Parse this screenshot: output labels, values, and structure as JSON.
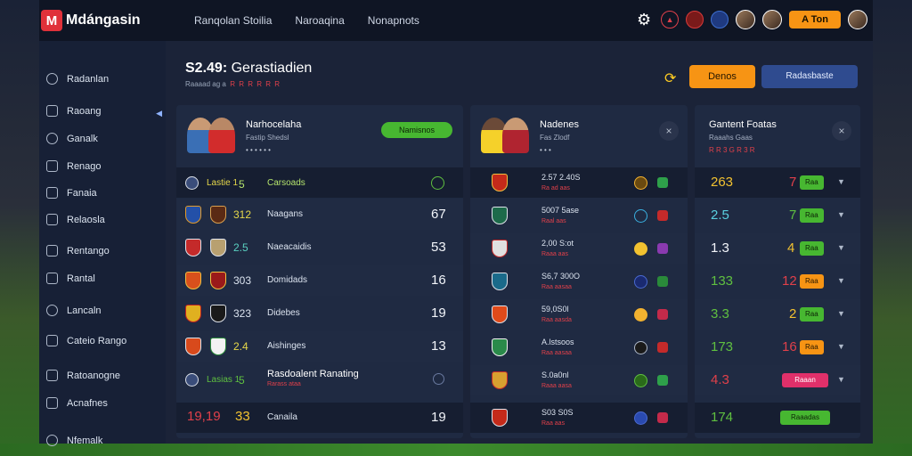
{
  "app": {
    "logo_mark": "M",
    "name": "Mdángasin"
  },
  "topnav": [
    "Ranqolan Stoilia",
    "Naroaqina",
    "Nonapnots"
  ],
  "top_actions": {
    "cta": "A Ton"
  },
  "sidebar": {
    "items": [
      "Radanlan",
      "Raoang",
      "Ganalk",
      "Renago",
      "Fanaia",
      "Relaosla",
      "Rentango",
      "Rantal",
      "Lancaln",
      "Cateio Rango",
      "Ratoanogne",
      "Acnafnes",
      "Nfemalk"
    ]
  },
  "header": {
    "title": "S2.49:",
    "title_suffix": "Gerastiadien",
    "sub_left": "Raaaad ag a",
    "sub_red": "R R R R R R",
    "btn_orange": "Denos",
    "btn_blue": "Radasbaste"
  },
  "colors": {
    "accent_orange": "#f79414",
    "accent_green": "#47b731",
    "accent_blue": "#2f4b8f",
    "accent_red": "#e0404a"
  },
  "panel1": {
    "title": "Narhocelaha",
    "sub": "Fastip Shedsl",
    "meta": "• • •   •   • •",
    "pill": "Namisnos",
    "rows": [
      {
        "left": "Lastie 1",
        "mid": "5",
        "name": "Carsoads",
        "value": ""
      },
      {
        "left": "",
        "mid": "312",
        "name": "Naagans",
        "value": "67"
      },
      {
        "left": "",
        "mid": "2.5",
        "name": "Naeacaidis",
        "value": "53"
      },
      {
        "left": "",
        "mid": "303",
        "name": "Domidads",
        "value": "16"
      },
      {
        "left": "",
        "mid": "323",
        "name": "Didebes",
        "value": "19"
      },
      {
        "left": "",
        "mid": "2.4",
        "name": "Aishinges",
        "value": "13"
      },
      {
        "left": "Lasias 1",
        "mid": "5",
        "name": "Rasdoalent Ranating",
        "value": ""
      },
      {
        "left": "19,19",
        "mid": "33",
        "name": "Canaila",
        "value": "19"
      }
    ],
    "row6_sub": "Rarass ataa"
  },
  "panel2": {
    "title": "Nadenes",
    "sub": "Fas Zlodf",
    "meta": "• • •",
    "close": "×",
    "rows": [
      {
        "line1": "2.57 2.40S",
        "line2": "Ra ad aas"
      },
      {
        "line1": "5007 5ase",
        "line2": "Raal aas"
      },
      {
        "line1": "2,00 S:ot",
        "line2": "Raaa aas"
      },
      {
        "line1": "S6,7 300O",
        "line2": "Raa aasaa"
      },
      {
        "line1": "59,0S0l",
        "line2": "Raa aasda"
      },
      {
        "line1": "A.lstsoos",
        "line2": "Raa aasaa"
      },
      {
        "line1": "S.0a0nl",
        "line2": "Raaa aasa"
      },
      {
        "line1": "S03 S0S",
        "line2": "Raa aas"
      }
    ]
  },
  "panel3": {
    "title": "Gantent Foatas",
    "sub": "Raaahs Gaas",
    "meta_red": "R R 3 G R 3 R",
    "close": "×",
    "rows": [
      {
        "left": "263",
        "right": "7",
        "tag": "Raa"
      },
      {
        "left": "2.5",
        "right": "7",
        "tag": "Raa"
      },
      {
        "left": "1.3",
        "right": "4",
        "tag": "Raa"
      },
      {
        "left": "133",
        "right": "12",
        "tag": "Raa"
      },
      {
        "left": "3.3",
        "right": "2",
        "tag": "Raa"
      },
      {
        "left": "173",
        "right": "16",
        "tag": "Raa"
      },
      {
        "left": "4.3",
        "right": "",
        "tag": "Raaan"
      },
      {
        "left": "174",
        "right": "",
        "tag": "Raaadas"
      }
    ]
  }
}
